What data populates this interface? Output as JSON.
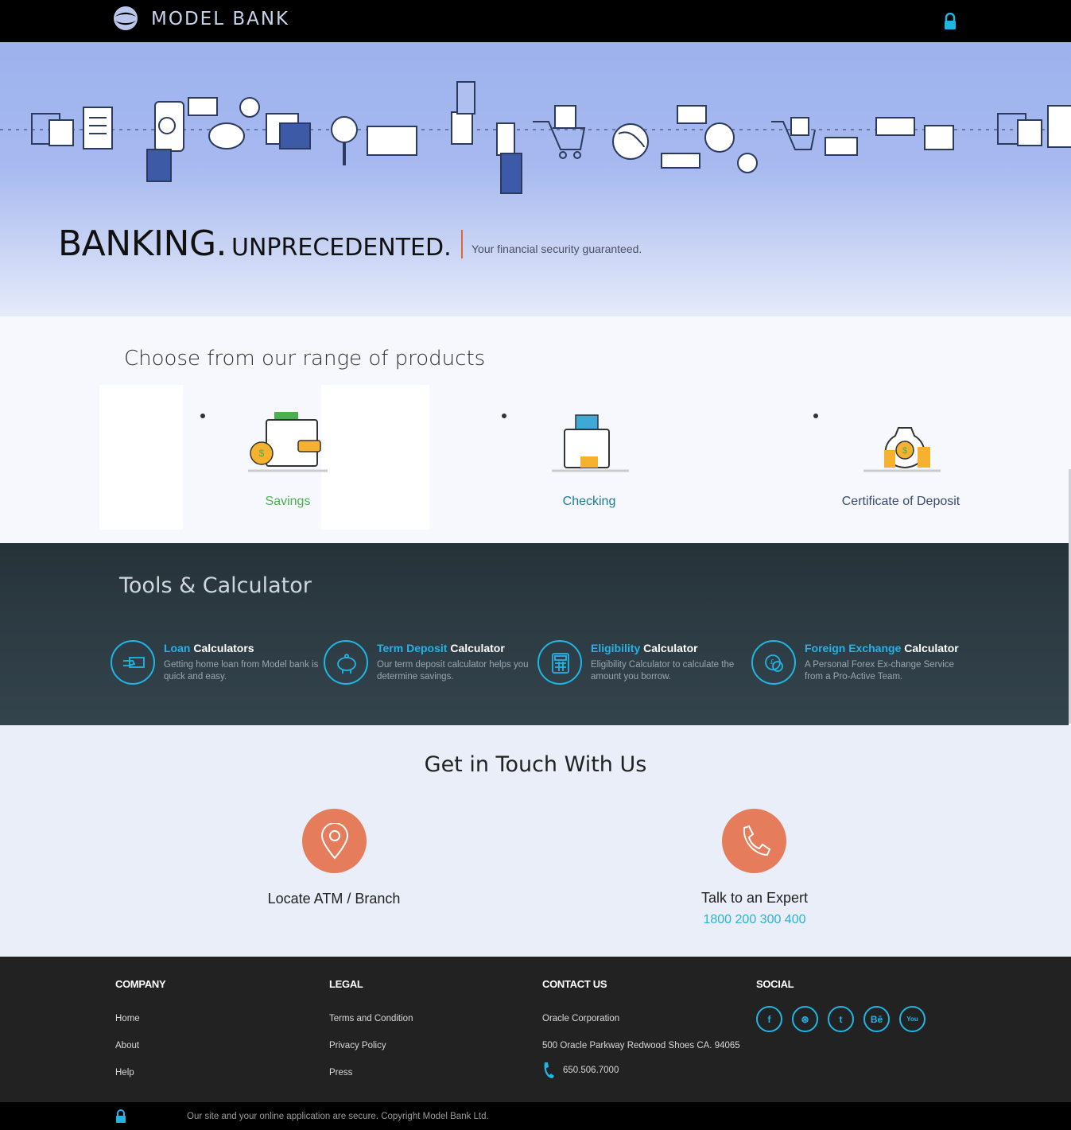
{
  "header": {
    "brand": "MODEL BANK",
    "icons": [
      "logo-icon",
      "lock-icon"
    ]
  },
  "hero": {
    "title_big": "BANKING.",
    "title_medium": "UNPRECEDENTED.",
    "subtitle": "Your financial security guaranteed."
  },
  "products": {
    "title": "Choose from our range of products",
    "items": [
      {
        "label": "Savings",
        "color": "#4caf50",
        "icon": "wallet-icon"
      },
      {
        "label": "Checking",
        "color": "#1b7a99",
        "icon": "card-icon"
      },
      {
        "label": "Certificate of Deposit",
        "color": "#3b4a72",
        "icon": "money-bag-icon"
      }
    ]
  },
  "tools": {
    "title": "Tools & Calculator",
    "items": [
      {
        "highlight": "Loan",
        "rest": " Calculators",
        "desc": "Getting home loan from Model bank is quick and easy.",
        "icon": "loan-icon"
      },
      {
        "highlight": "Term Deposit",
        "rest": " Calculator",
        "desc": "Our term deposit calculator helps you determine savings.",
        "icon": "piggy-bank-icon"
      },
      {
        "highlight": "Eligibility",
        "rest": " Calculator",
        "desc": "Eligibility Calculator to calculate the amount you borrow.",
        "icon": "calculator-icon"
      },
      {
        "highlight": "Foreign Exchange",
        "rest": " Calculator",
        "desc": "A Personal Forex Ex-change Service from a Pro-Active Team.",
        "icon": "exchange-icon"
      }
    ]
  },
  "contact": {
    "title": "Get in Touch With Us",
    "locate_label": "Locate ATM / Branch",
    "expert_label": "Talk to an Expert",
    "expert_phone": "1800 200 300 400"
  },
  "footer": {
    "company": {
      "heading": "COMPANY",
      "links": [
        "Home",
        "About",
        "Help"
      ]
    },
    "legal": {
      "heading": "LEGAL",
      "links": [
        "Terms and Condition",
        "Privacy Policy",
        "Press"
      ]
    },
    "contact": {
      "heading": "CONTACT US",
      "org": "Oracle Corporation",
      "address": "500 Oracle Parkway Redwood Shoes CA. 94065",
      "phone": "650.506.7000"
    },
    "social": {
      "heading": "SOCIAL",
      "items": [
        "f",
        "⊛",
        "t",
        "Bē",
        "You"
      ]
    },
    "copyright": "Our site and your online application are secure. Copyright Model Bank Ltd."
  },
  "colors": {
    "accent": "#1fb6e6",
    "orange": "#e57c5b"
  }
}
